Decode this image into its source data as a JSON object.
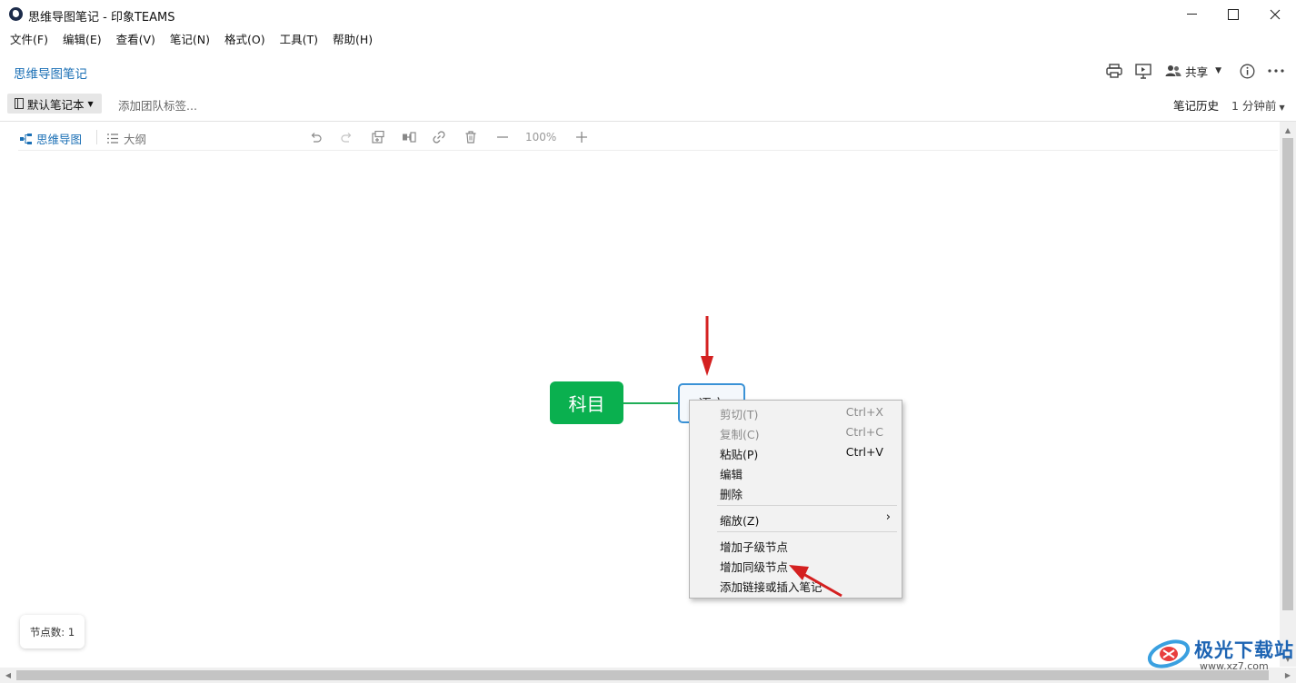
{
  "window": {
    "title": "思维导图笔记 - 印象TEAMS",
    "icons": [
      "app-logo-icon",
      "minimize-icon",
      "maximize-icon",
      "close-icon"
    ]
  },
  "menu": [
    "文件(F)",
    "编辑(E)",
    "查看(V)",
    "笔记(N)",
    "格式(O)",
    "工具(T)",
    "帮助(H)"
  ],
  "note": {
    "title": "思维导图笔记",
    "share_label": "共享",
    "notebook": "默认笔记本",
    "add_tag": "添加团队标签...",
    "history_label": "笔记历史",
    "time_ago": "1 分钟前"
  },
  "editor": {
    "tab_mindmap": "思维导图",
    "tab_outline": "大纲",
    "zoom": "100%"
  },
  "mindmap": {
    "root": "科目",
    "child": "语文"
  },
  "context_menu": {
    "items": [
      {
        "label": "剪切(T)",
        "shortcut": "Ctrl+X"
      },
      {
        "label": "复制(C)",
        "shortcut": "Ctrl+C"
      },
      {
        "label": "粘贴(P)",
        "shortcut": "Ctrl+V"
      },
      {
        "label": "编辑"
      },
      {
        "label": "删除"
      },
      {
        "label": "缩放(Z)"
      },
      {
        "label": "增加子级节点"
      },
      {
        "label": "增加同级节点"
      },
      {
        "label": "添加链接或插入笔记"
      }
    ]
  },
  "status": {
    "node_count": "节点数: 1"
  },
  "watermark": {
    "title": "极光下载站",
    "url": "www.xz7.com"
  },
  "colors": {
    "accent": "#1a6fb5",
    "root_node": "#0ab04f",
    "child_border": "#3a92d6",
    "arrow": "#d42020"
  }
}
